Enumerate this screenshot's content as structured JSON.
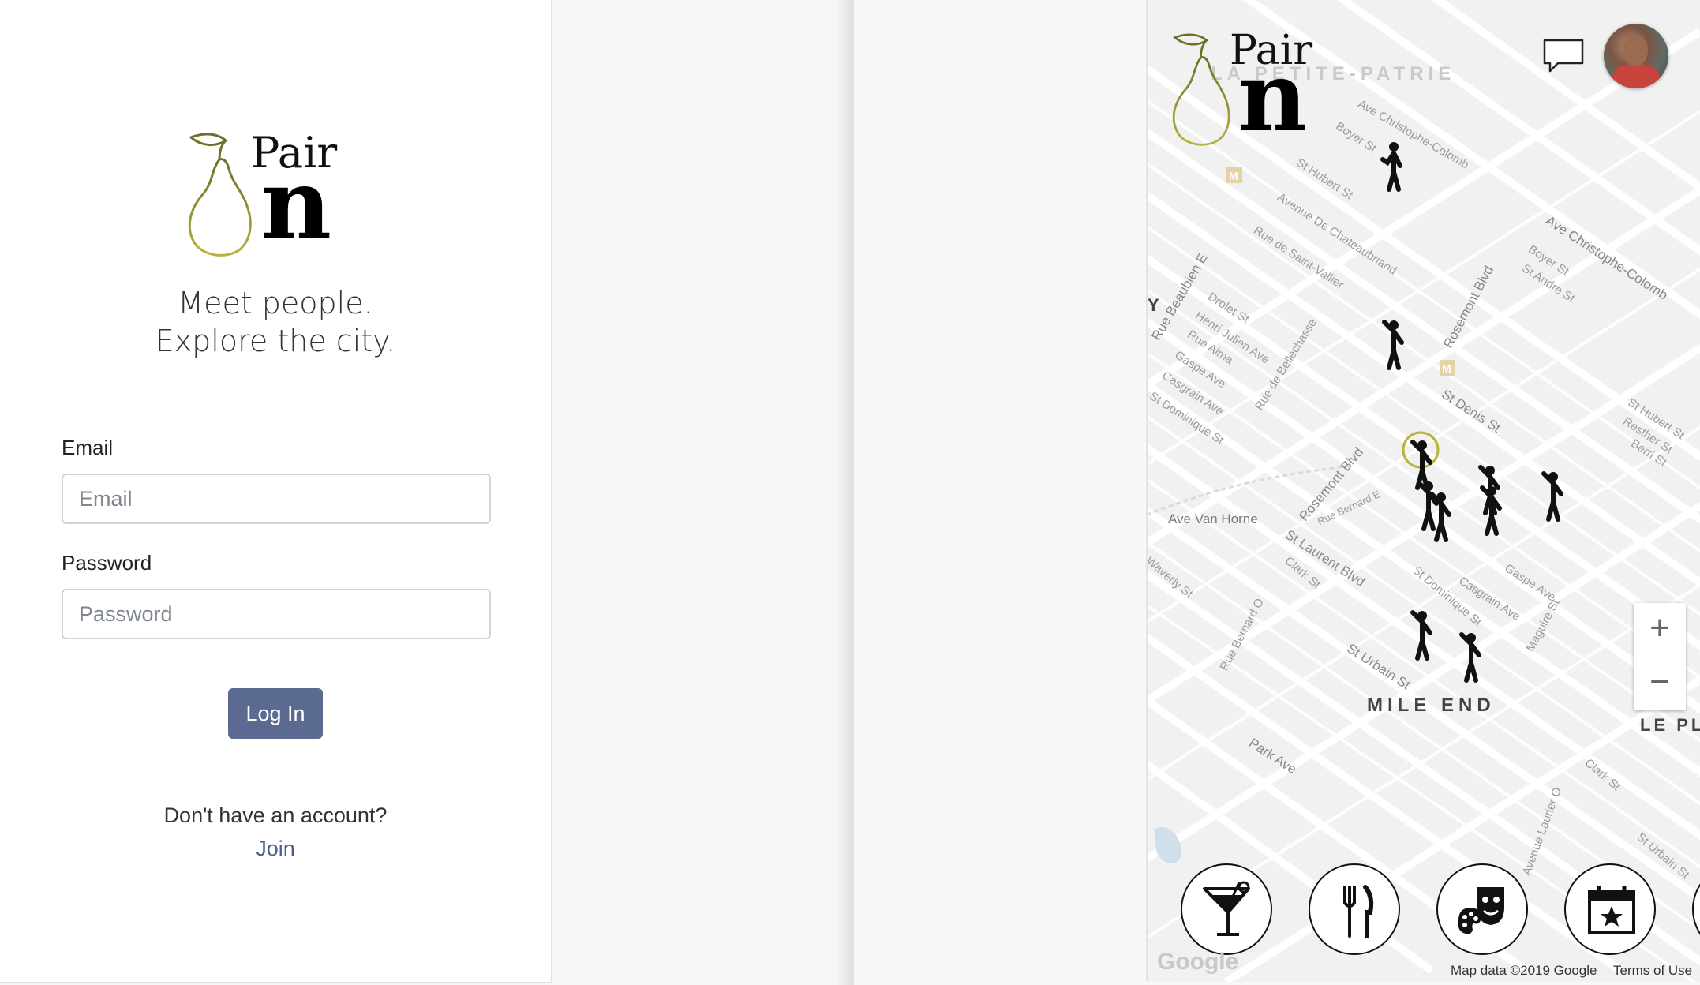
{
  "login": {
    "logo": {
      "word": "Pair",
      "letter": "n"
    },
    "tagline_line1": "Meet people.",
    "tagline_line2": "Explore the city.",
    "email_label": "Email",
    "email_placeholder": "Email",
    "password_label": "Password",
    "password_placeholder": "Password",
    "login_button": "Log In",
    "no_account_text": "Don't have an account?",
    "join_link": "Join"
  },
  "map": {
    "logo": {
      "word": "Pair",
      "letter": "n"
    },
    "areas": {
      "top": "LA PETITE-PATRIE",
      "center": "MILE END",
      "right": "LE PL",
      "left": "Y"
    },
    "streets": {
      "s1": "Ave Christophe-Colomb",
      "s2": "Ave Christophe-Colomb",
      "s3": "St Hubert St",
      "s4": "Avenue De Chateaubriand",
      "s5": "Rue de Saint-Vallier",
      "s6": "Boyer St",
      "s7": "Rue Beaubien E",
      "s8": "Drolet St",
      "s9": "Henri Julien Ave",
      "s10": "Rue Alma",
      "s11": "Gaspe Ave",
      "s12": "Casgrain Ave",
      "s13": "St Dominique St",
      "s14": "Rue de Bellechasse",
      "s15": "Rosemont Blvd",
      "s16": "St Denis St",
      "s17": "Rosemont Blvd",
      "s18": "Ave Van Horne",
      "s19": "St Laurent Blvd",
      "s20": "Rue Bernard E",
      "s21": "Clark St",
      "s22": "St Dominique St",
      "s23": "Casgrain Ave",
      "s24": "Gaspe Ave",
      "s25": "St Urbain St",
      "s26": "Park Ave",
      "s27": "Waverly St",
      "s28": "Rue Bernard O",
      "s29": "Boyer St",
      "s30": "St Andre St",
      "s31": "St Hubert St",
      "s32": "Resther St",
      "s33": "Berri St",
      "s34": "Clark St",
      "s35": "St Urbain St",
      "s36": "Avenue Laurier O",
      "s37": "Maguire St"
    },
    "zoom_in": "+",
    "zoom_out": "−",
    "attribution": "Map data ©2019 Google",
    "terms": "Terms of Use",
    "google": "Google",
    "categories": [
      {
        "name": "drinks",
        "icon": "cocktail-icon"
      },
      {
        "name": "food",
        "icon": "fork-knife-icon"
      },
      {
        "name": "arts",
        "icon": "theater-masks-palette-icon"
      },
      {
        "name": "events",
        "icon": "calendar-star-icon"
      }
    ]
  },
  "colors": {
    "primary_button": "#5b6a91",
    "link": "#4a5f8c",
    "logo_pear": "#8a8a2a",
    "map_background": "#f1f1f1"
  }
}
